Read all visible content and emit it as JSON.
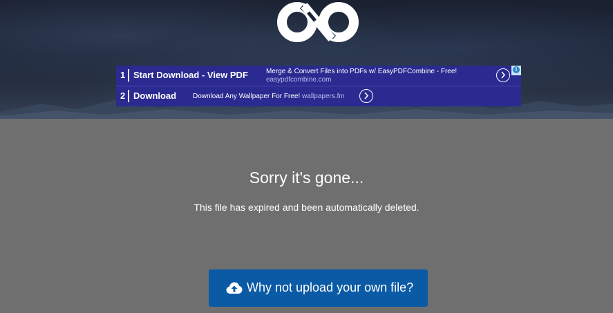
{
  "ad": {
    "row1": {
      "number": "1",
      "title": "Start Download - View PDF",
      "description": "Merge & Convert Files into PDFs w/ EasyPDFCombine - Free!",
      "url": "easypdfcombine.com"
    },
    "row2": {
      "number": "2",
      "title": "Download",
      "description": "Download Any Wallpaper For Free!",
      "url": "wallpapers.fm"
    },
    "info_icon": "i"
  },
  "message": {
    "title": "Sorry it's gone...",
    "body": "This file has expired and been automatically deleted."
  },
  "cta": {
    "label": "Why not upload your own file?",
    "icon": "cloud-upload-icon"
  },
  "colors": {
    "ad_background": "#2a2a91",
    "page_background": "#6f6f6f",
    "button": "#0a5aa5"
  }
}
